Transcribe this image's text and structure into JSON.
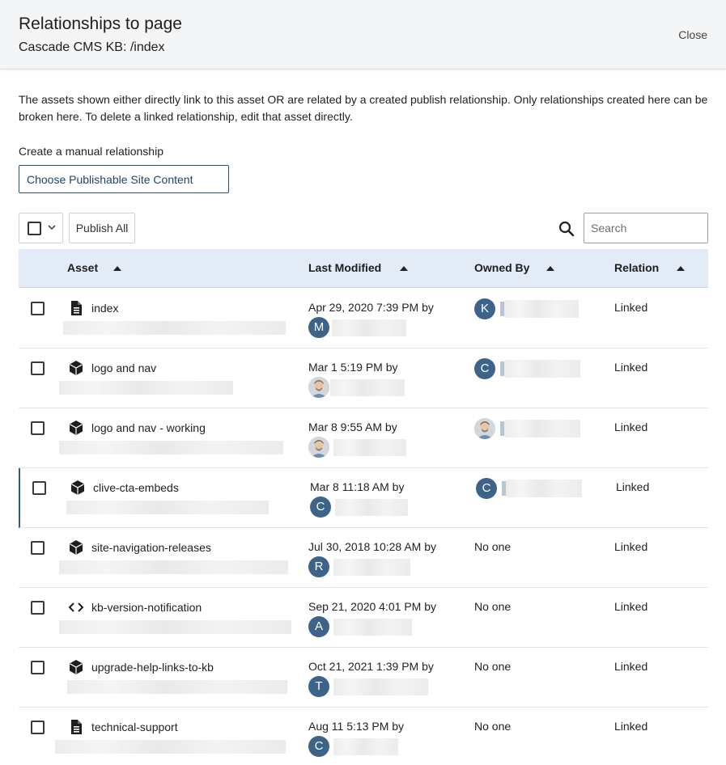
{
  "dialog": {
    "title": "Relationships to page",
    "subtitle": "Cascade CMS KB: /index",
    "close_label": "Close"
  },
  "description": "The assets shown either directly link to this asset OR are related by a created publish relationship. Only relationships created here can be broken here. To delete a linked relationship, edit that asset directly.",
  "manual": {
    "label": "Create a manual relationship",
    "button_label": "Choose Publishable Site Content"
  },
  "toolbar": {
    "publish_all_label": "Publish All",
    "search_placeholder": "Search"
  },
  "columns": {
    "asset": "Asset",
    "last_modified": "Last Modified",
    "owned_by": "Owned By",
    "relation": "Relation"
  },
  "rows": [
    {
      "name": "index",
      "type_icon": "page-icon",
      "modified": "Apr 29, 2020 7:39 PM by",
      "modifier_initial": "M",
      "modifier_photo": false,
      "owner": "",
      "owner_initial": "K",
      "owner_photo": false,
      "relation": "Linked"
    },
    {
      "name": "logo and nav",
      "type_icon": "block-icon",
      "modified": "Mar 1 5:19 PM by",
      "modifier_initial": "",
      "modifier_photo": true,
      "owner": "",
      "owner_initial": "C",
      "owner_photo": false,
      "relation": "Linked"
    },
    {
      "name": "logo and nav - working",
      "type_icon": "block-icon",
      "modified": "Mar 8 9:55 AM by",
      "modifier_initial": "",
      "modifier_photo": true,
      "owner": "",
      "owner_initial": "",
      "owner_photo": true,
      "relation": "Linked"
    },
    {
      "name": "clive-cta-embeds",
      "type_icon": "block-icon",
      "modified": "Mar 8 11:18 AM by",
      "modifier_initial": "C",
      "modifier_photo": false,
      "owner": "",
      "owner_initial": "C",
      "owner_photo": false,
      "relation": "Linked"
    },
    {
      "name": "site-navigation-releases",
      "type_icon": "block-icon",
      "modified": "Jul 30, 2018 10:28 AM by",
      "modifier_initial": "R",
      "modifier_photo": false,
      "owner": "No one",
      "owner_initial": "",
      "owner_photo": false,
      "relation": "Linked"
    },
    {
      "name": "kb-version-notification",
      "type_icon": "code-icon",
      "modified": "Sep 21, 2020 4:01 PM by",
      "modifier_initial": "A",
      "modifier_photo": false,
      "owner": "No one",
      "owner_initial": "",
      "owner_photo": false,
      "relation": "Linked"
    },
    {
      "name": "upgrade-help-links-to-kb",
      "type_icon": "block-icon",
      "modified": "Oct 21, 2021 1:39 PM by",
      "modifier_initial": "T",
      "modifier_photo": false,
      "owner": "No one",
      "owner_initial": "",
      "owner_photo": false,
      "relation": "Linked"
    },
    {
      "name": "technical-support",
      "type_icon": "page-icon",
      "modified": "Aug 11 5:13 PM by",
      "modifier_initial": "C",
      "modifier_photo": false,
      "owner": "No one",
      "owner_initial": "",
      "owner_photo": false,
      "relation": "Linked"
    }
  ],
  "colors": {
    "accent": "#2b4f77",
    "avatar": "#3d6389",
    "header_row": "#e2ebf6"
  }
}
